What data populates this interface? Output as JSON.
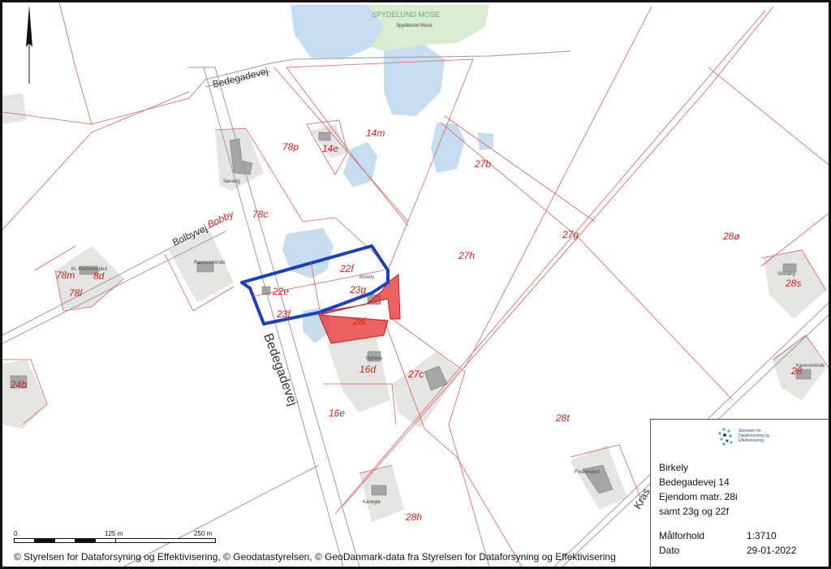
{
  "map": {
    "region_labels": {
      "nature_area": "SPYDELUND MOSE",
      "nature_area_small": "Spydelund Mose"
    },
    "roads": {
      "main_road": "Bedegadevej",
      "north_road": "Bedegadevej",
      "west_road": "Bolbyvej",
      "west_road_suffix": "Bobby",
      "east_road": "Kras"
    },
    "parcels": [
      "78p",
      "14e",
      "14m",
      "27b",
      "78c",
      "27g",
      "28ø",
      "22f",
      "22e",
      "23g",
      "27h",
      "23f",
      "28i",
      "28s",
      "16d",
      "27c",
      "28",
      "24b",
      "16e",
      "28t",
      "28h",
      "78m",
      "8d",
      "78l"
    ],
    "places": [
      "Søvang",
      "Rasmusminde",
      "Kl. Klemensgård",
      "Birkely",
      "Nyhave",
      "Solvang",
      "Karensminde",
      "Fredenslyst",
      "Kanegle"
    ],
    "highlight_color": "#e83a3a",
    "outline_color": "#1a3fbf"
  },
  "scale": {
    "label_0": "0",
    "label_125": "125 m",
    "label_250": "250 m"
  },
  "info": {
    "logo_text": "Styrelsen for Dataforsyning og Effektivisering",
    "title": "Birkely",
    "address": "Bedegadevej 14",
    "property": "Ejendom matr. 28i",
    "also": "samt 23g og 22f",
    "scale_label": "Målforhold",
    "scale_value": "1:3710",
    "date_label": "Dato",
    "date_value": "29-01-2022"
  },
  "copyright": "© Styrelsen for Dataforsyning og Effektivisering, © Geodatastyrelsen, © GeoDanmark-data fra Styrelsen for Dataforsyning og Effektivisering"
}
